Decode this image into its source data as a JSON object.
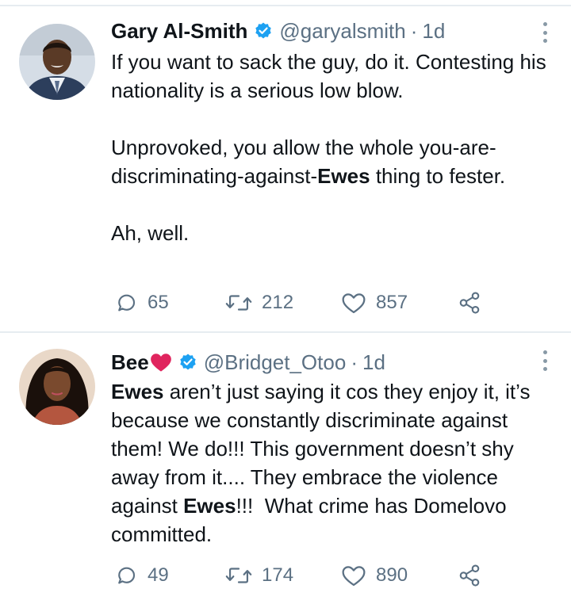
{
  "tweets": [
    {
      "author_name": "Gary Al-Smith",
      "verified": true,
      "handle": "@garyalsmith",
      "separator": "·",
      "time": "1d",
      "paragraphs": [
        [
          {
            "text": "If you want to sack the guy, do it. Contesting his nationality is a serious low blow.",
            "bold": false
          }
        ],
        [
          {
            "text": "Unprovoked, you allow the whole you-are-discriminating-against-",
            "bold": false
          },
          {
            "text": "Ewes",
            "bold": true
          },
          {
            "text": " thing to fester.",
            "bold": false
          }
        ],
        [
          {
            "text": "Ah, well.",
            "bold": false
          }
        ]
      ],
      "replies": "65",
      "retweets": "212",
      "likes": "857"
    },
    {
      "author_name": "Bee",
      "name_emoji": "red-heart",
      "verified": true,
      "handle": "@Bridget_Otoo",
      "separator": "·",
      "time": "1d",
      "paragraphs": [
        [
          {
            "text": "Ewes",
            "bold": true
          },
          {
            "text": " aren’t just saying it cos they enjoy it, it’s because we constantly discriminate against them! We do!!! This government doesn’t shy away from it.... They embrace the violence against ",
            "bold": false
          },
          {
            "text": "Ewes",
            "bold": true
          },
          {
            "text": "!!!  What crime has Domelovo committed.",
            "bold": false
          }
        ]
      ],
      "replies": "49",
      "retweets": "174",
      "likes": "890"
    }
  ],
  "colors": {
    "text": "#0f1419",
    "secondary": "#5b7083",
    "verified": "#1da1f2",
    "divider": "#e6ecf0",
    "heart": "#e0245e"
  },
  "icons": {
    "reply": "reply-icon",
    "retweet": "retweet-icon",
    "like": "like-icon",
    "share": "share-icon",
    "more": "more-options-icon",
    "verified": "verified-badge-icon"
  }
}
